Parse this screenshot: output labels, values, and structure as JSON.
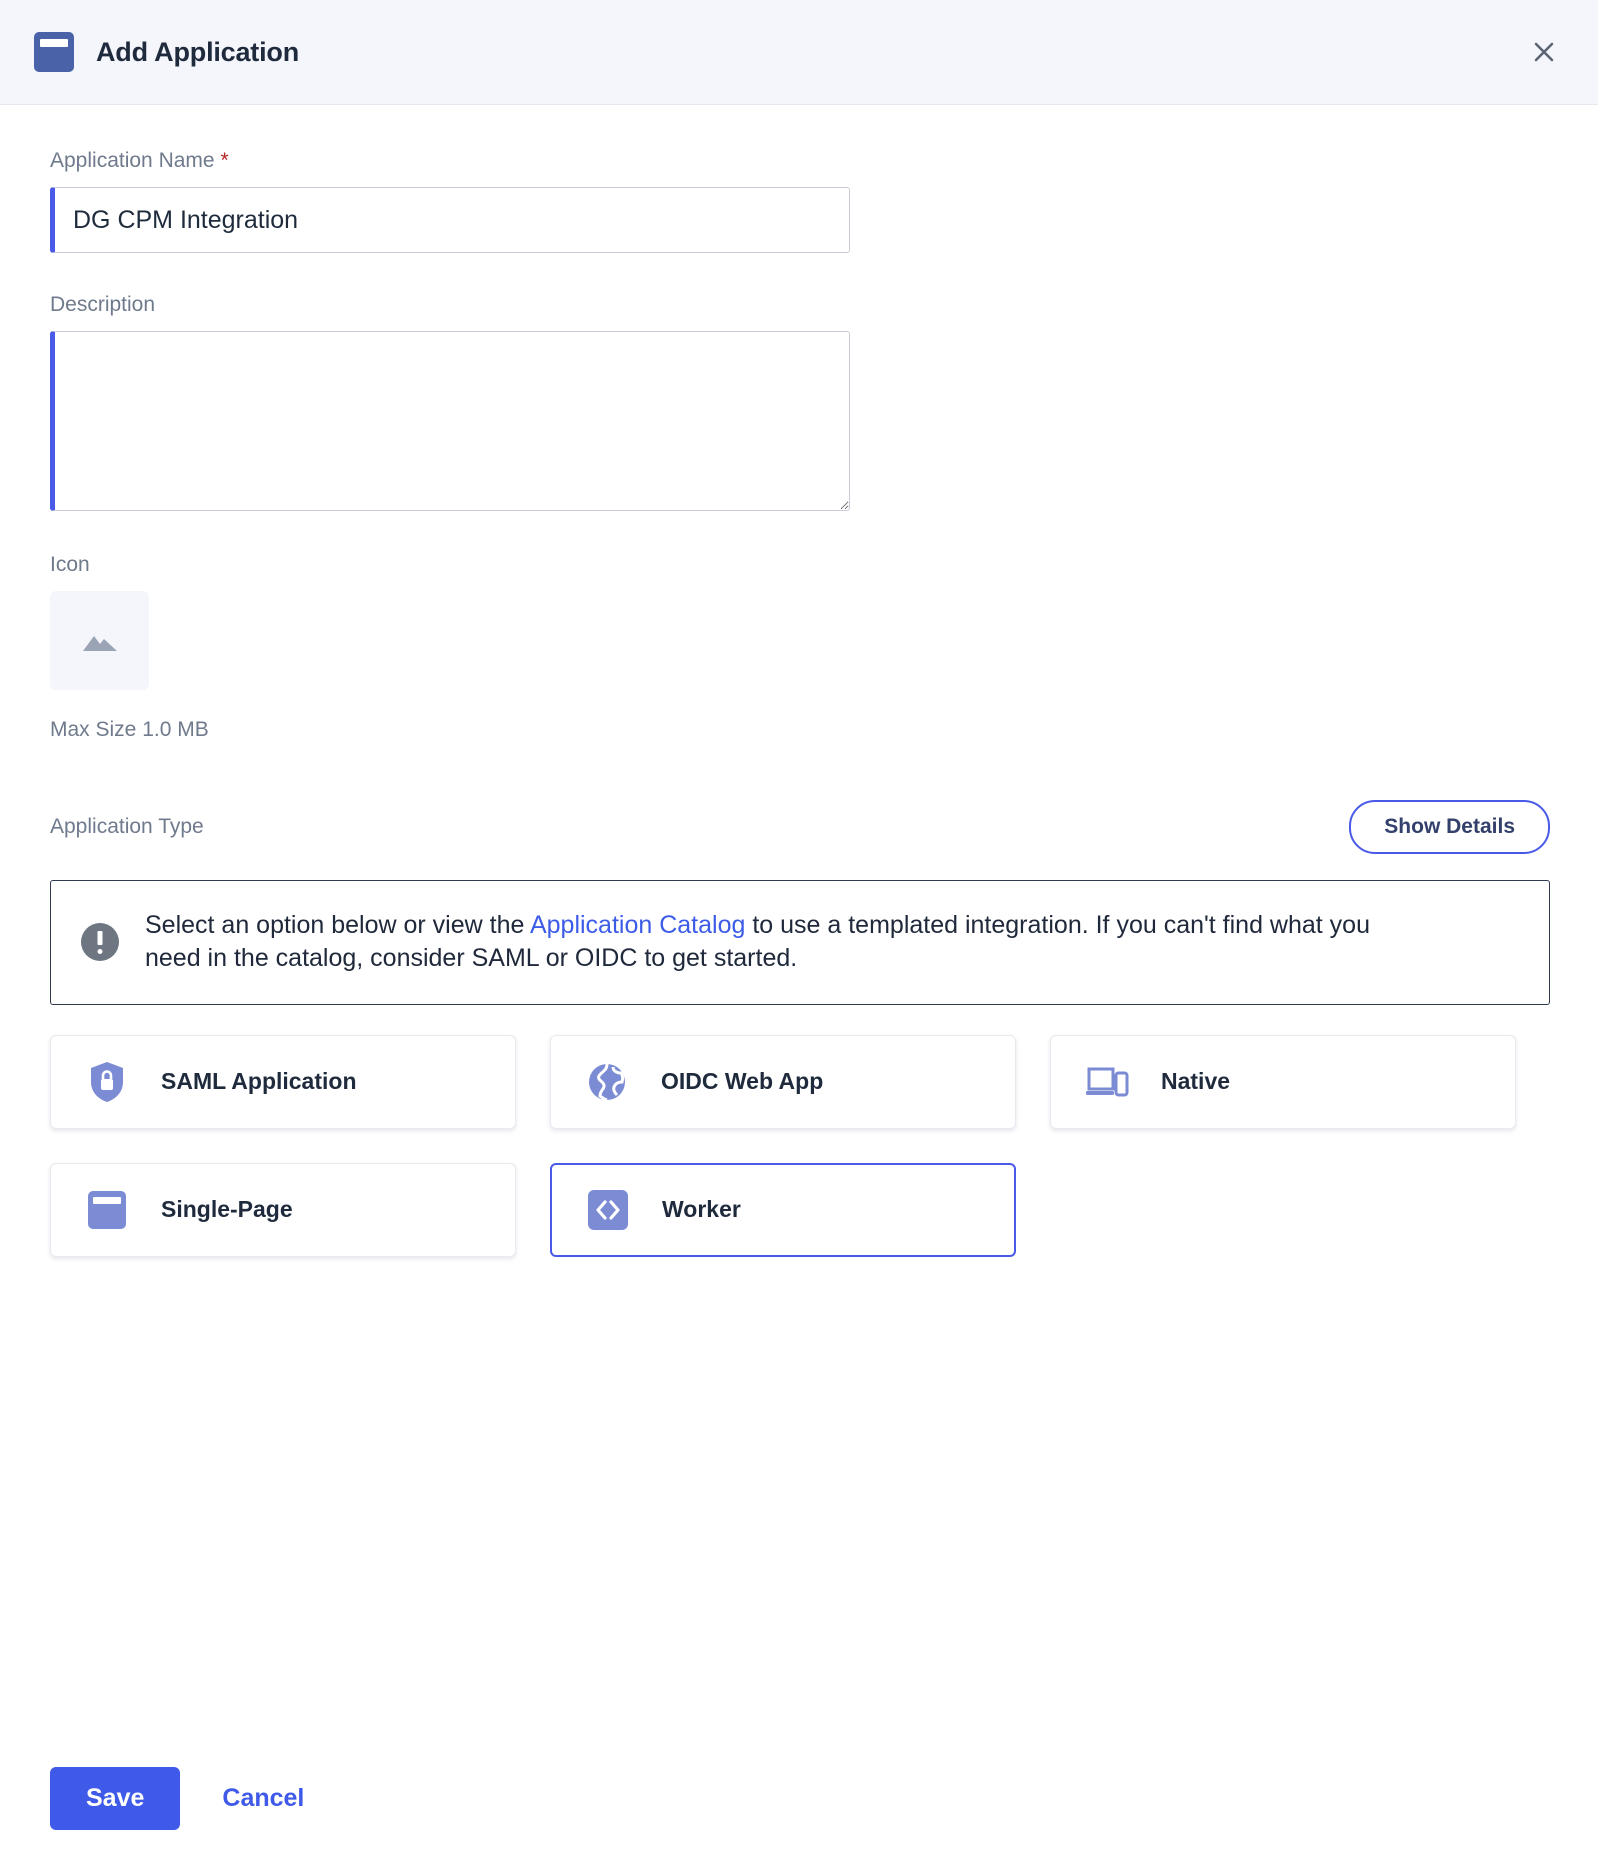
{
  "header": {
    "title": "Add Application",
    "app_icon": "browser-window-icon",
    "close_label": "close-icon"
  },
  "form": {
    "name_field": {
      "label": "Application Name",
      "required_marker": "*",
      "value": "DG CPM Integration",
      "placeholder": ""
    },
    "description_field": {
      "label": "Description",
      "value": "",
      "placeholder": ""
    },
    "icon_field": {
      "label": "Icon",
      "placeholder_icon": "image-placeholder-icon",
      "max_size_text": "Max Size 1.0 MB"
    }
  },
  "application_type": {
    "label": "Application Type",
    "show_details_label": "Show Details",
    "banner": {
      "icon": "info-exclamation-icon",
      "text_before_link": "Select an option below or view the ",
      "link_text": "Application Catalog",
      "text_after_link": " to use a templated integration. If you can't find what you need in the catalog, consider SAML or OIDC to get started."
    },
    "options": [
      {
        "label": "SAML Application",
        "icon": "shield-lock-icon",
        "selected": false
      },
      {
        "label": "OIDC Web App",
        "icon": "globe-icon",
        "selected": false
      },
      {
        "label": "Native",
        "icon": "laptop-phone-icon",
        "selected": false
      },
      {
        "label": "Single-Page",
        "icon": "browser-window-icon",
        "selected": false
      },
      {
        "label": "Worker",
        "icon": "code-brackets-icon",
        "selected": true
      }
    ]
  },
  "footer": {
    "save_label": "Save",
    "cancel_label": "Cancel"
  },
  "colors": {
    "accent_blue": "#3f5ae8",
    "header_bg": "#f5f6fb",
    "icon_periwinkle": "#7b8bd4",
    "required_red": "#b62626",
    "link_blue": "#3c5ce8",
    "text_dark": "#1f2b3d",
    "label_gray": "#6f7a8c"
  }
}
